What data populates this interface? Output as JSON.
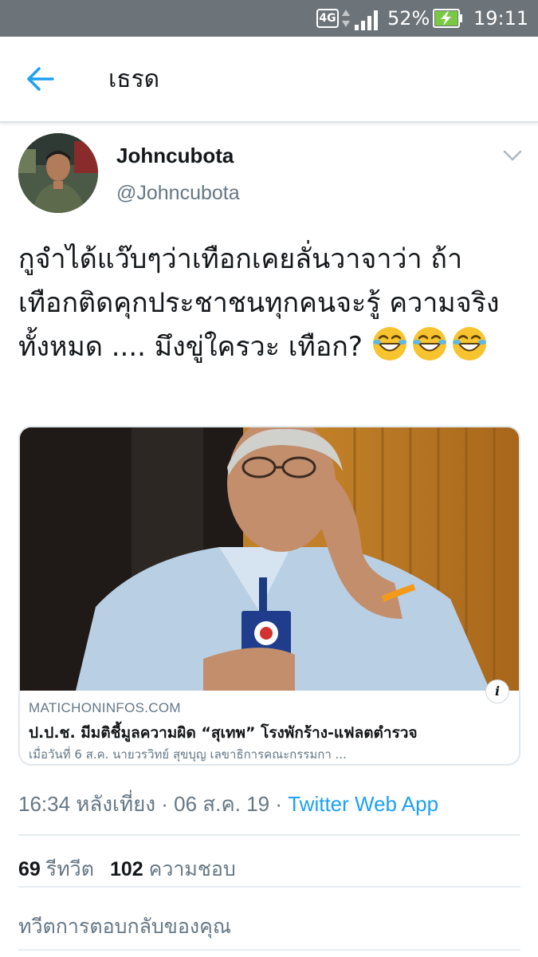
{
  "status_bar": {
    "network": "4G",
    "battery_percent": "52%",
    "time": "19:11",
    "colors": {
      "background": "#6d7479",
      "battery_fill": "#7ac943"
    }
  },
  "app_bar": {
    "title": "เธรด",
    "back_icon": "arrow-left-icon",
    "accent": "#1da1f2"
  },
  "tweet": {
    "display_name": "Johncubota",
    "handle": "@Johncubota",
    "text": "กูจำได้แว๊บๆว่าเทือกเคยลั่นวาจาว่า ถ้าเทือกติดคุกประชาชนทุกคนจะรู้ ความจริงทั้งหมด .... มึงขู่ใครวะ เทือก?",
    "emojis": [
      "face-with-tears-of-joy-icon",
      "face-with-tears-of-joy-icon",
      "face-with-tears-of-joy-icon"
    ],
    "card": {
      "domain": "MATICHONINFOS.COM",
      "title": "ป.ป.ช. มีมติชี้มูลความผิด “สุเทพ” โรงพักร้าง-แฟลตตำรวจ",
      "description": "เมื่อวันที่ 6 ส.ค. นายวรวิทย์ สุขบุญ เลขาธิการคณะกรรมกา ...",
      "info_label": "i"
    },
    "timestamp": "16:34 หลังเที่ยง · 06 ส.ค. 19 · ",
    "source_app": "Twitter Web App",
    "retweet_count": "69",
    "retweet_label": "รีทวีต",
    "like_count": "102",
    "like_label": "ความชอบ"
  },
  "reply_prompt": "ทวีตการตอบกลับของคุณ"
}
